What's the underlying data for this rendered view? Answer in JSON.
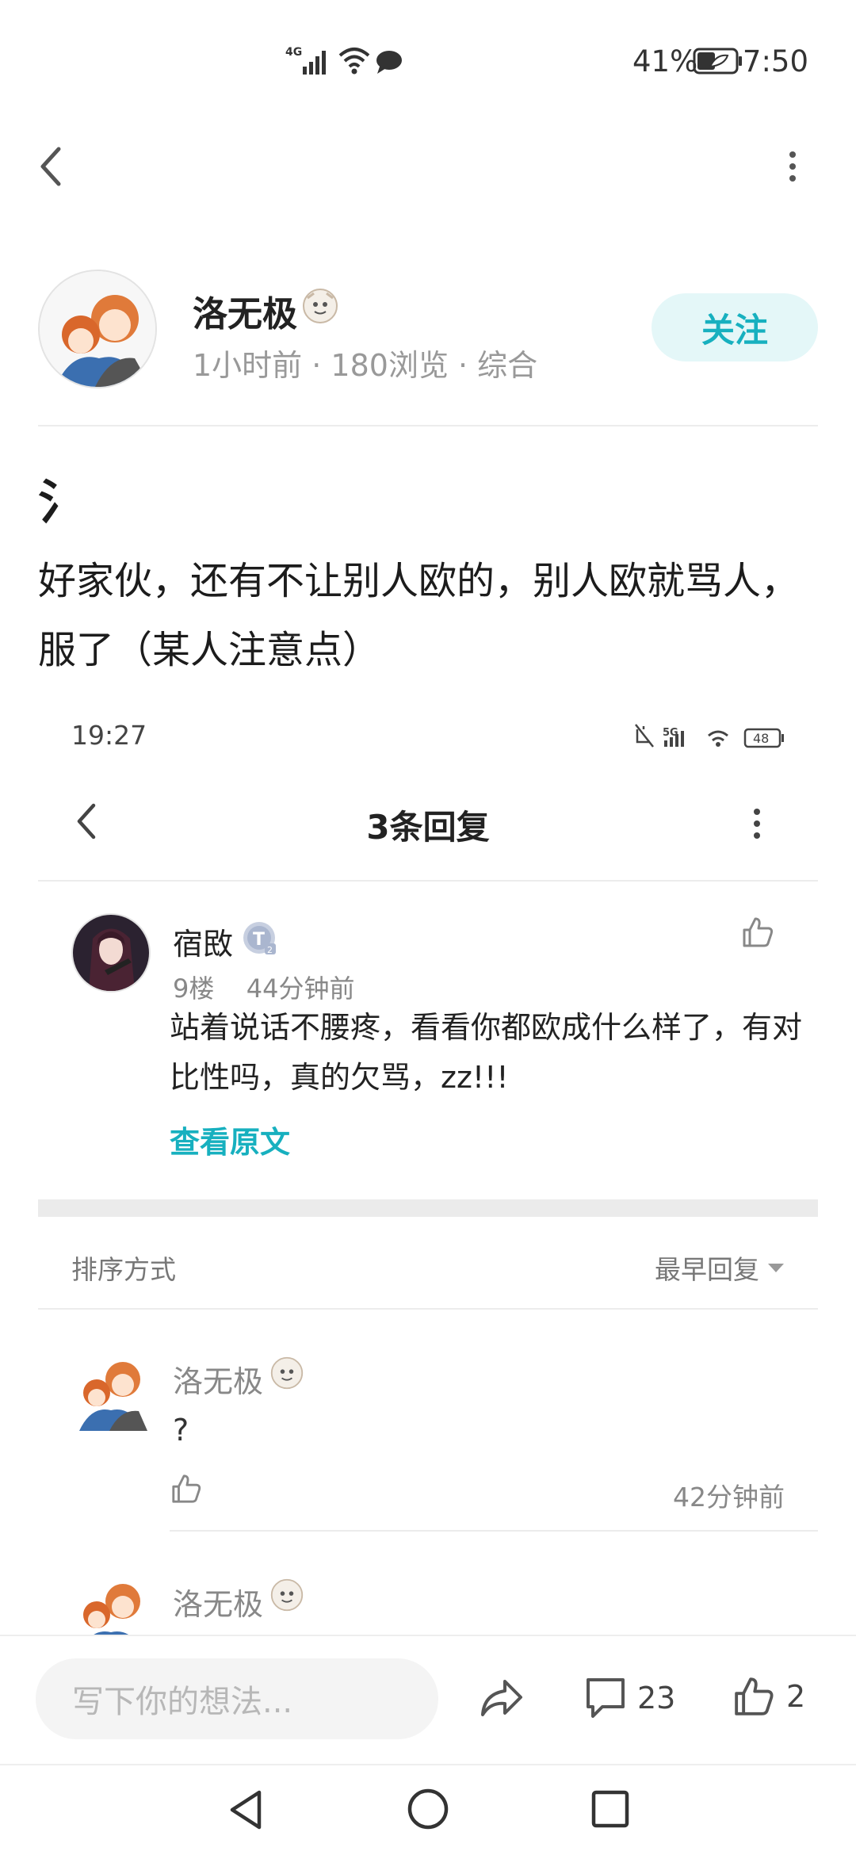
{
  "status_bar": {
    "network": "4G",
    "battery_percent": "41%",
    "time": "7:50"
  },
  "post": {
    "author": {
      "name": "洛无极",
      "meta": "1小时前 · 180浏览 · 综合"
    },
    "follow_label": "关注",
    "title": "氵",
    "body": "好家伙，还有不让别人欧的，别人欧就骂人，服了（某人注意点）"
  },
  "screenshot": {
    "status_time": "19:27",
    "battery": "48",
    "title": "3条回复",
    "comment": {
      "author": "宿敃",
      "badge": "T",
      "floor": "9楼",
      "time": "44分钟前",
      "text": "站着说话不腰疼，看看你都欧成什么样了，有对比性吗，真的欠骂，zz!!!",
      "view_original": "查看原文"
    },
    "sort": {
      "label": "排序方式",
      "value": "最早回复"
    },
    "replies": [
      {
        "author": "洛无极",
        "text": "?",
        "time": "42分钟前"
      },
      {
        "author": "洛无极"
      }
    ]
  },
  "bottom_bar": {
    "input_placeholder": "写下你的想法...",
    "comment_count": "23",
    "like_count": "2"
  },
  "colors": {
    "accent": "#17b0bf",
    "follow_bg": "#e4f7f8"
  },
  "icons": [
    "back-icon",
    "more-icon",
    "share-icon",
    "comment-icon",
    "like-icon",
    "nav-back-icon",
    "nav-home-icon",
    "nav-recent-icon"
  ]
}
